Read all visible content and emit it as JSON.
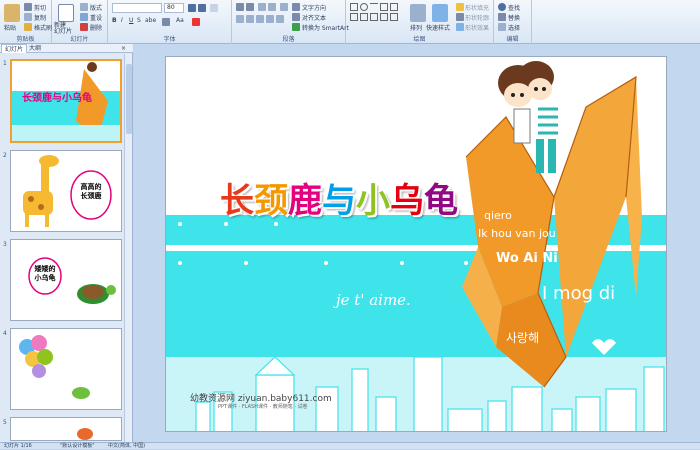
{
  "ribbon": {
    "clipboard": {
      "label": "剪贴板",
      "paste": "粘贴",
      "cut": "剪切",
      "copy": "复制",
      "format_painter": "格式刷"
    },
    "slides": {
      "label": "幻灯片",
      "new_slide": "新建\n幻灯片",
      "layout": "版式",
      "reset": "重设",
      "delete": "删除"
    },
    "font": {
      "label": "字体",
      "font_name": "",
      "font_size": "80"
    },
    "paragraph": {
      "label": "段落",
      "text_direction": "文字方向",
      "align_text": "对齐文本",
      "smartart": "转换为 SmartArt"
    },
    "drawing": {
      "label": "绘图",
      "arrange": "排列",
      "quick_styles": "快速样式",
      "shape_fill": "形状填充",
      "shape_outline": "形状轮廓",
      "shape_effects": "形状效果"
    },
    "editing": {
      "label": "编辑",
      "find": "查找",
      "replace": "替换",
      "select": "选择"
    }
  },
  "panel": {
    "tabs": [
      "幻灯片",
      "大纲"
    ],
    "thumb_numbers": [
      "1",
      "2",
      "3",
      "4",
      "5"
    ],
    "thumb1_title": "长颈鹿与小乌龟",
    "thumb2_label": "高高的\n长颈鹿",
    "thumb3_label": "矮矮的\n小乌龟"
  },
  "slide": {
    "title_chars": [
      "长",
      "颈",
      "鹿",
      "与",
      "小",
      "乌",
      "龟"
    ],
    "title_colors": [
      "#e8391d",
      "#f39800",
      "#e4007f",
      "#00a0e9",
      "#8fc31f",
      "#e60012",
      "#920783"
    ],
    "words": [
      "qiero",
      "Ik hou van jou",
      "Wo Ai Ni",
      "I mog di",
      "사랑해",
      "je t' aime."
    ],
    "footer_site": "幼教资源网 ziyuan.baby611.com",
    "footer_sub": "PPT课件 · FLASH课件 · 教师随笔 · 试卷"
  },
  "status": {
    "slide_info": "幻灯片 1/16",
    "theme": "\"默认设计模板\"",
    "language": "中文(简体, 中国)"
  },
  "colors": {
    "sea": "#3fe3ea",
    "crane": "#f19a2a",
    "ribbon_bg": "#dbe7f5"
  }
}
